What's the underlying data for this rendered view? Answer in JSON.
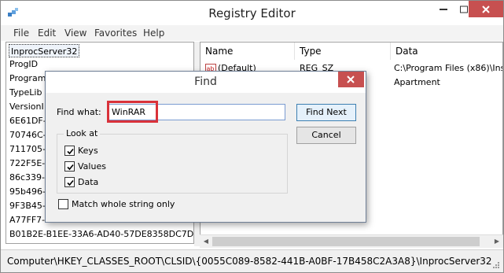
{
  "window": {
    "title": "Registry Editor"
  },
  "menu": [
    "File",
    "Edit",
    "View",
    "Favorites",
    "Help"
  ],
  "tree": [
    "InprocServer32",
    "ProgID",
    "Program",
    "TypeLib",
    "VersionI",
    "6E61DF-1",
    "70746C-9",
    "711705-1",
    "722F5E-C",
    "86c339-9",
    "95b496-f",
    "9F3B45-8",
    "A77FF7-A",
    "B01B2E-B1EE-33A6-AD40-57DE8358DC7D}"
  ],
  "list": {
    "columns": [
      "Name",
      "Type",
      "Data"
    ],
    "rows": [
      {
        "name": "(Default)",
        "type": "REG_SZ",
        "data": "C:\\Program Files (x86)\\Inst"
      },
      {
        "name": "",
        "type": "",
        "data": "Apartment"
      }
    ]
  },
  "status": {
    "path": "Computer\\HKEY_CLASSES_ROOT\\CLSID\\{0055C089-8582-441B-A0BF-17B458C2A3A8}\\InprocServer32"
  },
  "find_dialog": {
    "title": "Find",
    "find_what_label": "Find what:",
    "find_what_value": "WinRAR",
    "find_next_label": "Find Next",
    "cancel_label": "Cancel",
    "look_at_label": "Look at",
    "options": [
      {
        "label": "Keys",
        "checked": true
      },
      {
        "label": "Values",
        "checked": true
      },
      {
        "label": "Data",
        "checked": true
      }
    ],
    "whole_string_label": "Match whole string only",
    "whole_string_checked": false
  },
  "colors": {
    "close_button": "#c75050",
    "highlight": "#d9323a"
  }
}
